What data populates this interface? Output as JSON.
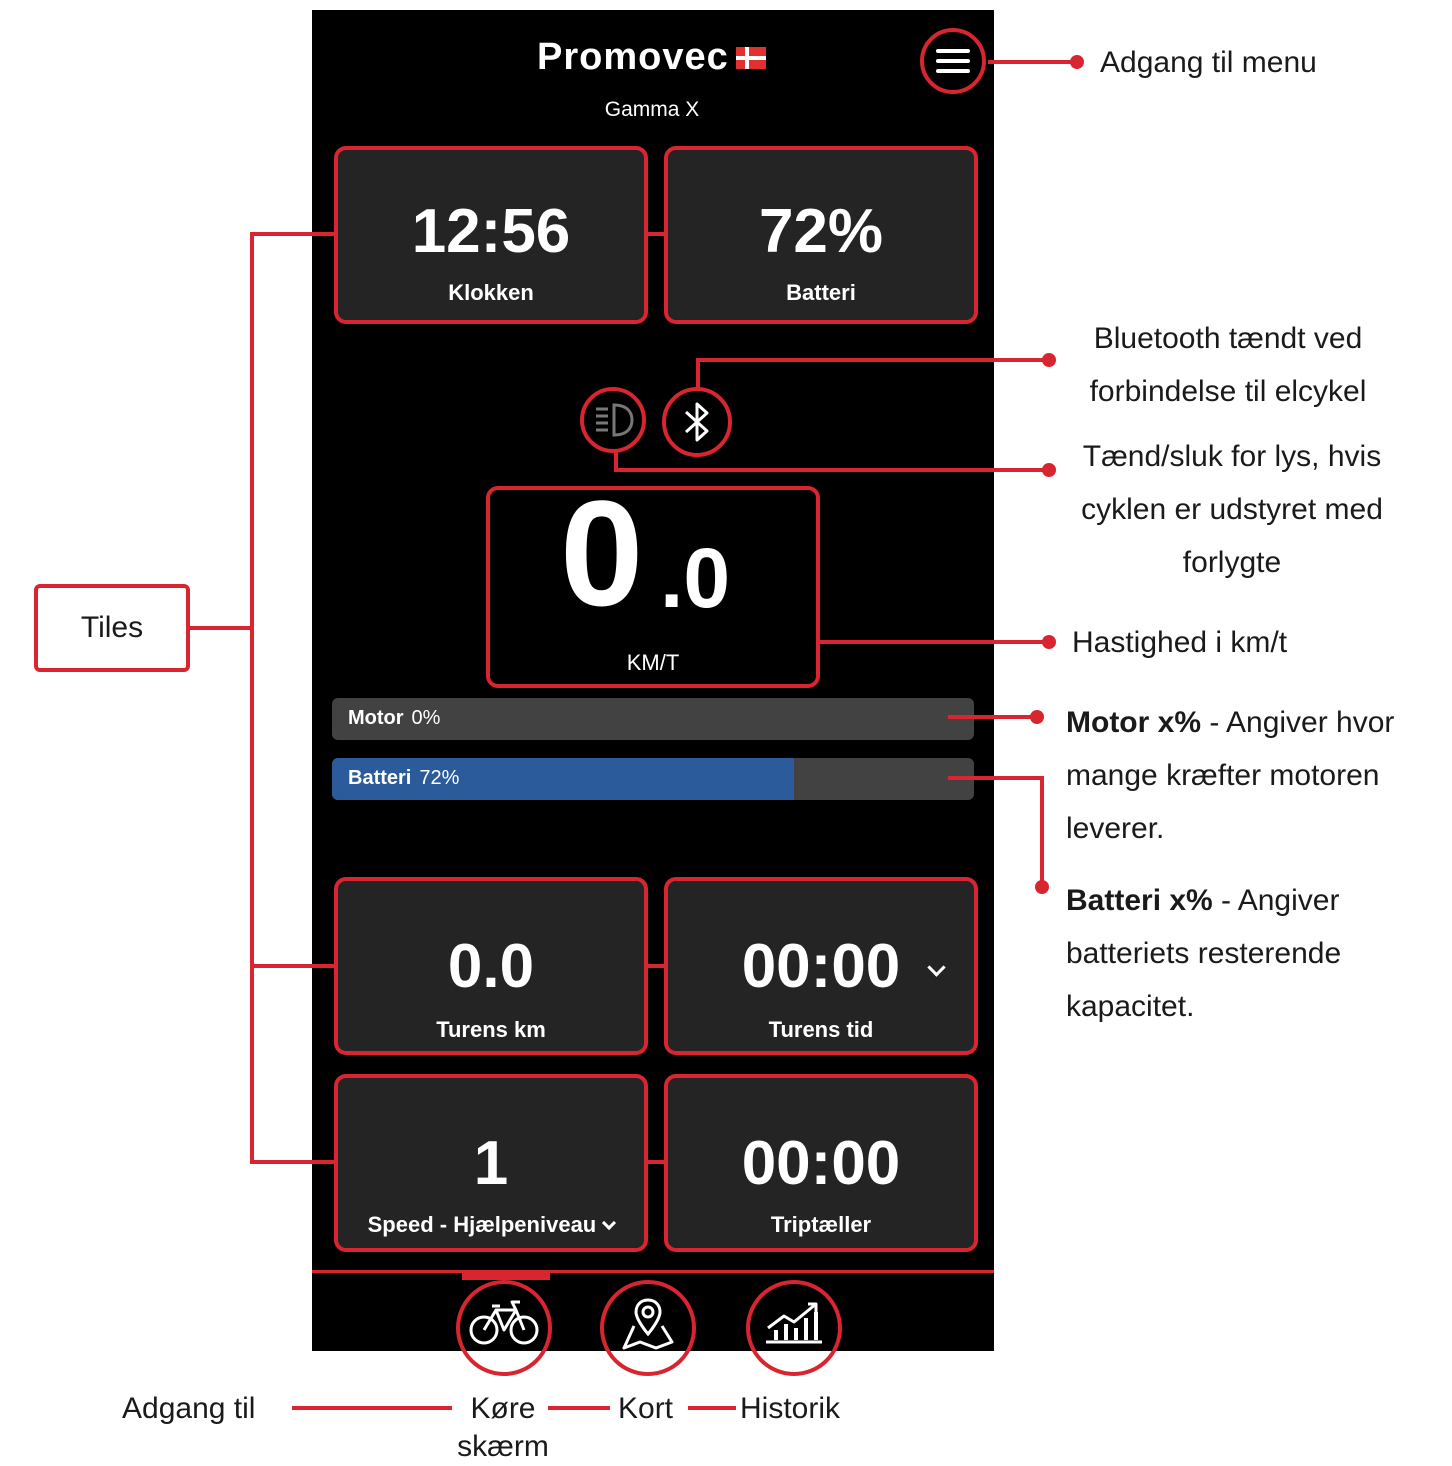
{
  "header": {
    "brand": "Promovec",
    "model": "Gamma X"
  },
  "tiles": {
    "clock": {
      "value": "12:56",
      "label": "Klokken"
    },
    "battery": {
      "value": "72%",
      "label": "Batteri"
    },
    "trip_km": {
      "value": "0.0",
      "label": "Turens km"
    },
    "trip_time": {
      "value": "00:00",
      "label": "Turens tid"
    },
    "assist": {
      "value": "1",
      "label": "Speed - Hjælpeniveau"
    },
    "trip_counter": {
      "value": "00:00",
      "label": "Triptæller"
    }
  },
  "speed": {
    "integer": "0",
    "decimal": ".0",
    "unit": "KM/T"
  },
  "bars": {
    "motor": {
      "label": "Motor",
      "value_text": "0%",
      "fraction": 0.0,
      "color": "#424242"
    },
    "battery": {
      "label": "Batteri",
      "value_text": "72%",
      "fraction": 0.72,
      "color": "#2b5b9a"
    }
  },
  "icons": {
    "menu": "hamburger-menu-icon",
    "headlight": "headlight-icon",
    "bluetooth": "bluetooth-icon",
    "bike": "bicycle-icon",
    "map": "map-pin-icon",
    "history": "bar-chart-trend-icon"
  },
  "annotations": {
    "menu": "Adgang til menu",
    "bluetooth_line1": "Bluetooth tændt ved",
    "bluetooth_line2": "forbindelse til elcykel",
    "light_line1": "Tænd/sluk for lys, hvis",
    "light_line2": "cyklen er udstyret med",
    "light_line3": "forlygte",
    "speed": "Hastighed i km/t",
    "motor_bold": "Motor x%",
    "motor_line1": " - Angiver hvor",
    "motor_line2": "mange kræfter motoren",
    "motor_line3": "leverer.",
    "battery_bold": "Batteri x%",
    "battery_line1": " - Angiver",
    "battery_line2": "batteriets resterende",
    "battery_line3": "kapacitet.",
    "tiles": "Tiles",
    "access": "Adgang til",
    "drive_line1": "Køre",
    "drive_line2": "skærm",
    "map": "Kort",
    "history": "Historik"
  },
  "colors": {
    "accent": "#d8252f",
    "tile_bg": "#242424",
    "screen_bg": "#000000"
  }
}
